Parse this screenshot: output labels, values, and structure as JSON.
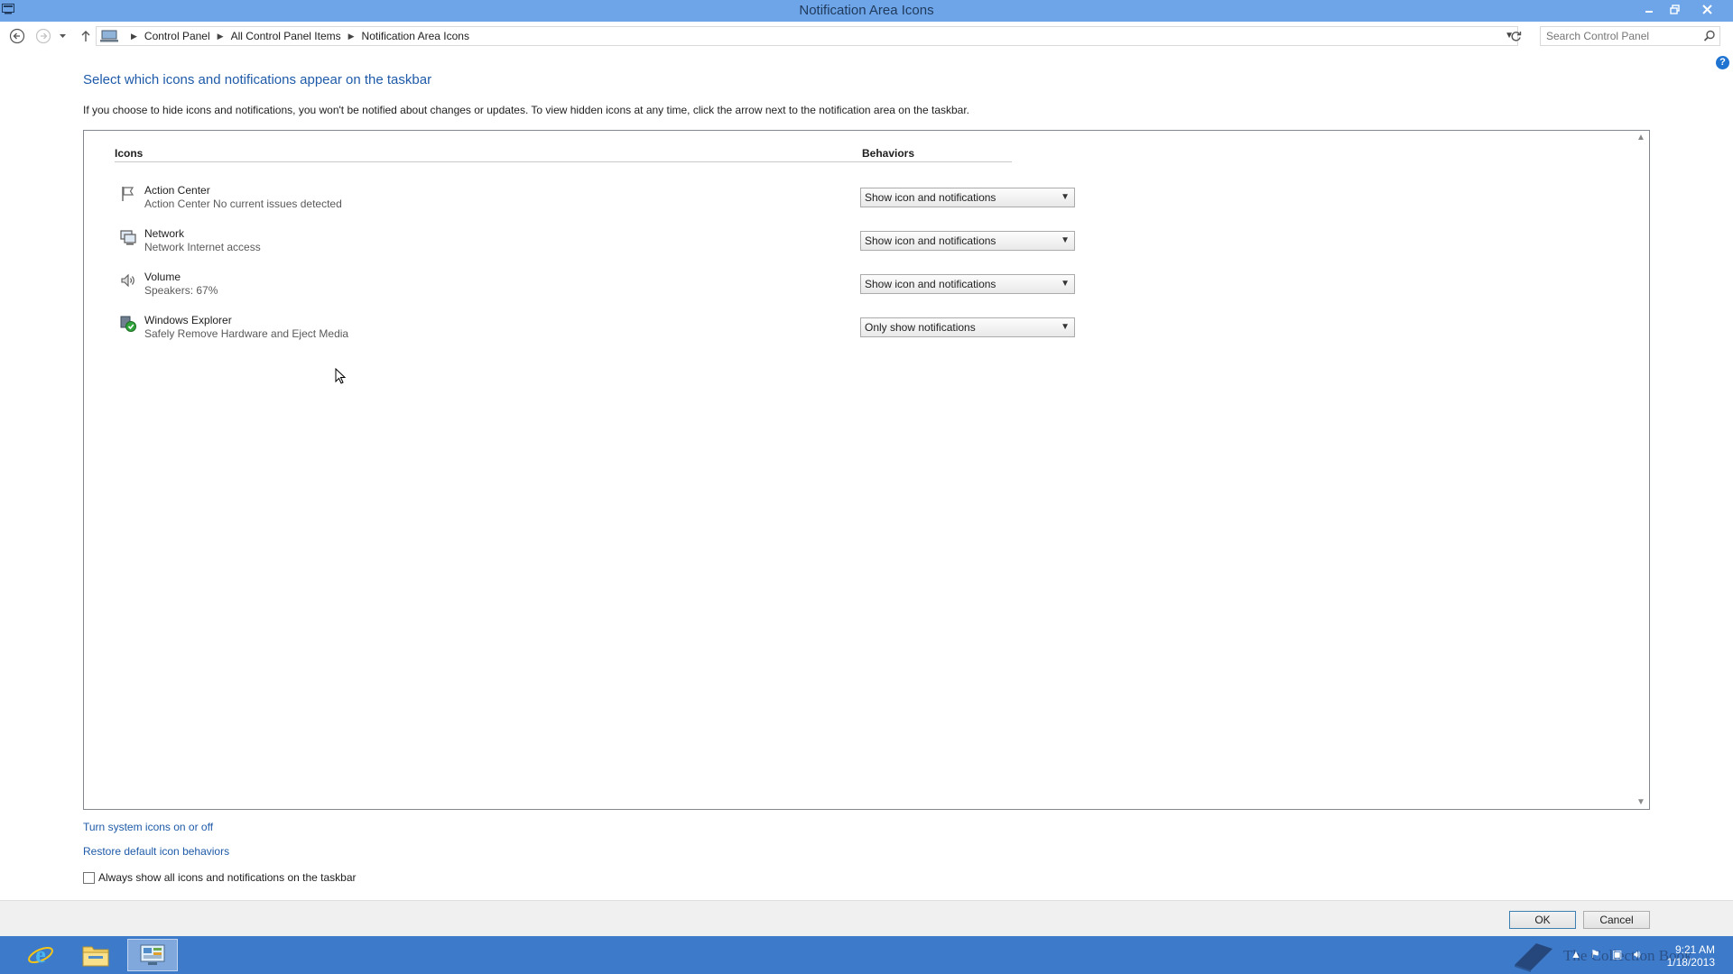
{
  "window": {
    "title": "Notification Area Icons"
  },
  "address": {
    "crumbs": [
      "Control Panel",
      "All Control Panel Items",
      "Notification Area Icons"
    ],
    "search_placeholder": "Search Control Panel"
  },
  "main": {
    "heading": "Select which icons and notifications appear on the taskbar",
    "description": "If you choose to hide icons and notifications, you won't be notified about changes or updates. To view hidden icons at any time, click the arrow next to the notification area on the taskbar.",
    "col_icons": "Icons",
    "col_behaviors": "Behaviors",
    "rows": [
      {
        "name": "Action Center",
        "sub": "Action Center  No current issues detected",
        "behavior": "Show icon and notifications",
        "icon": "flag-icon"
      },
      {
        "name": "Network",
        "sub": "Network Internet access",
        "behavior": "Show icon and notifications",
        "icon": "network-icon"
      },
      {
        "name": "Volume",
        "sub": "Speakers: 67%",
        "behavior": "Show icon and notifications",
        "icon": "speaker-icon"
      },
      {
        "name": "Windows Explorer",
        "sub": "Safely Remove Hardware and Eject Media",
        "behavior": "Only show notifications",
        "icon": "usb-eject-icon"
      }
    ]
  },
  "links": {
    "system_icons": "Turn system icons on or off",
    "restore": "Restore default icon behaviors",
    "always_show": "Always show all icons and notifications on the taskbar"
  },
  "footer": {
    "ok": "OK",
    "cancel": "Cancel"
  },
  "taskbar": {
    "time": "9:21 AM",
    "date": "1/18/2013",
    "watermark": "The Collection Book"
  },
  "colors": {
    "titlebar": "#6ea5e8",
    "taskbar": "#3d7ac9",
    "link": "#1e5aa8"
  }
}
